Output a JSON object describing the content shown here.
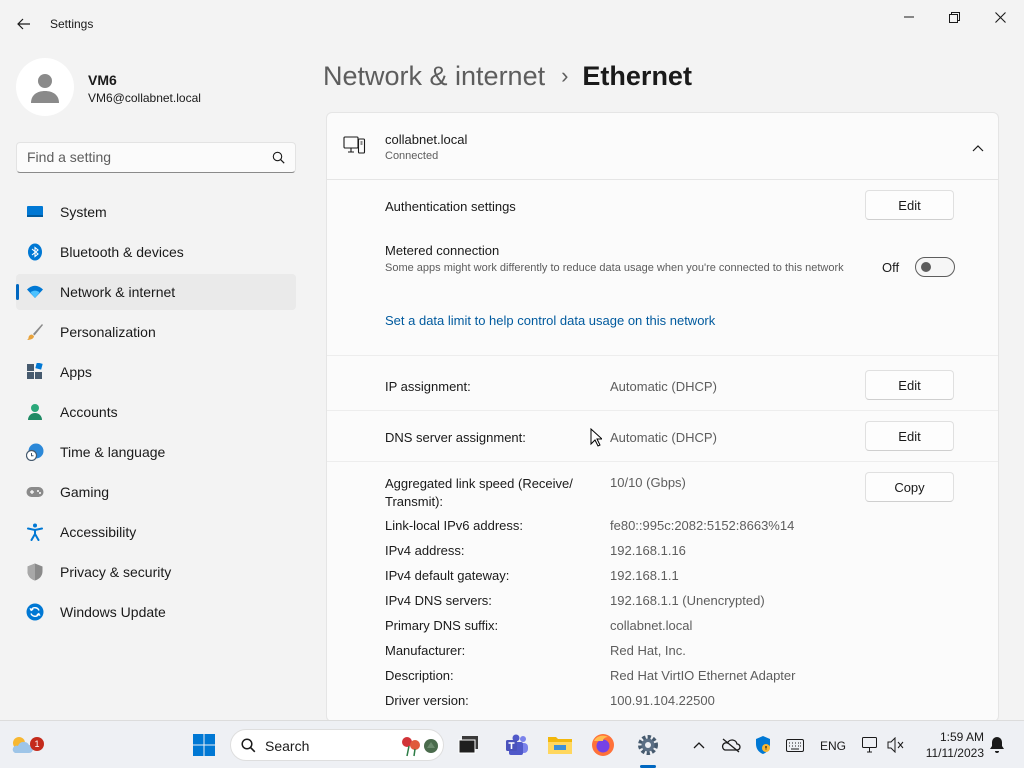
{
  "app": {
    "title": "Settings"
  },
  "profile": {
    "name": "VM6",
    "email": "VM6@collabnet.local"
  },
  "search": {
    "placeholder": "Find a setting"
  },
  "nav": {
    "items": [
      {
        "label": "System",
        "icon": "system-icon"
      },
      {
        "label": "Bluetooth & devices",
        "icon": "bluetooth-icon"
      },
      {
        "label": "Network & internet",
        "icon": "network-icon",
        "active": true
      },
      {
        "label": "Personalization",
        "icon": "brush-icon"
      },
      {
        "label": "Apps",
        "icon": "apps-icon"
      },
      {
        "label": "Accounts",
        "icon": "person-icon"
      },
      {
        "label": "Time & language",
        "icon": "globe-clock-icon"
      },
      {
        "label": "Gaming",
        "icon": "gamepad-icon"
      },
      {
        "label": "Accessibility",
        "icon": "accessibility-icon"
      },
      {
        "label": "Privacy & security",
        "icon": "shield-icon"
      },
      {
        "label": "Windows Update",
        "icon": "update-icon"
      }
    ]
  },
  "breadcrumb": {
    "parent": "Network & internet",
    "separator": "›",
    "current": "Ethernet"
  },
  "connection": {
    "name": "collabnet.local",
    "status": "Connected",
    "auth_label": "Authentication settings",
    "auth_button": "Edit",
    "metered_label": "Metered connection",
    "metered_desc": "Some apps might work differently to reduce data usage when you're connected to this network",
    "metered_state": "Off",
    "data_limit_link": "Set a data limit to help control data usage on this network",
    "ip_label": "IP assignment:",
    "ip_value": "Automatic (DHCP)",
    "ip_button": "Edit",
    "dns_label": "DNS server assignment:",
    "dns_value": "Automatic (DHCP)",
    "dns_button": "Edit",
    "copy_button": "Copy",
    "properties": [
      {
        "label": "Aggregated link speed (Receive/ Transmit):",
        "value": "10/10 (Gbps)"
      },
      {
        "label": "Link-local IPv6 address:",
        "value": "fe80::995c:2082:5152:8663%14"
      },
      {
        "label": "IPv4 address:",
        "value": "192.168.1.16"
      },
      {
        "label": "IPv4 default gateway:",
        "value": "192.168.1.1"
      },
      {
        "label": "IPv4 DNS servers:",
        "value": "192.168.1.1 (Unencrypted)"
      },
      {
        "label": "Primary DNS suffix:",
        "value": "collabnet.local"
      },
      {
        "label": "Manufacturer:",
        "value": "Red Hat, Inc."
      },
      {
        "label": "Description:",
        "value": "Red Hat VirtIO Ethernet Adapter"
      },
      {
        "label": "Driver version:",
        "value": "100.91.104.22500"
      }
    ]
  },
  "taskbar": {
    "search_label": "Search",
    "widget_badge": "1",
    "language": "ENG",
    "time": "1:59 AM",
    "date": "11/11/2023"
  },
  "colors": {
    "accent": "#0067c0",
    "link": "#005a9e",
    "badge": "#c42b1c"
  }
}
